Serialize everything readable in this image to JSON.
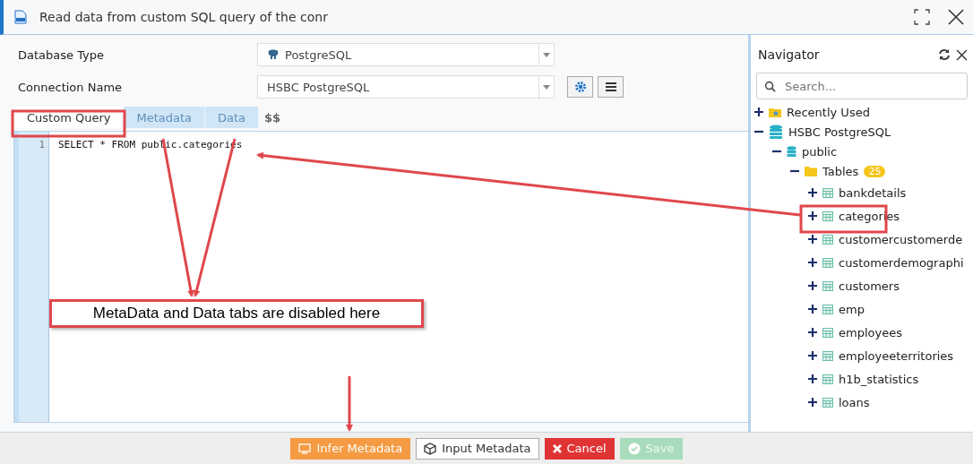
{
  "window": {
    "title": "Read data from custom SQL query of the conr"
  },
  "form": {
    "fields": [
      {
        "label": "Database Type",
        "value": "PostgreSQL",
        "kind": "dbtype"
      },
      {
        "label": "Connection Name",
        "value": "HSBC PostgreSQL",
        "kind": "connection"
      }
    ]
  },
  "tabs": [
    {
      "label": "Custom Query",
      "selected": true,
      "disabled": false
    },
    {
      "label": "Metadata",
      "selected": false,
      "disabled": true
    },
    {
      "label": "Data",
      "selected": false,
      "disabled": true
    }
  ],
  "tabs_extra": "$$",
  "editor": {
    "lines": [
      {
        "number": "1",
        "text": "SELECT * FROM public.categories"
      }
    ]
  },
  "annotation": {
    "callout": "MetaData and Data tabs are disabled here"
  },
  "navigator": {
    "title": "Navigator",
    "search": {
      "placeholder": "Search..."
    },
    "tree": [
      {
        "label": "Recently Used",
        "kind": "recent",
        "expanded": false
      },
      {
        "label": "HSBC PostgreSQL",
        "kind": "database",
        "expanded": true,
        "children": [
          {
            "label": "public",
            "kind": "schema",
            "expanded": true,
            "children": [
              {
                "label": "Tables",
                "kind": "folder",
                "badge": "25",
                "expanded": true,
                "children": [
                  {
                    "label": "bankdetails",
                    "kind": "table",
                    "expanded": false
                  },
                  {
                    "label": "categories",
                    "kind": "table",
                    "expanded": false
                  },
                  {
                    "label": "customercustomerde",
                    "kind": "table",
                    "expanded": false
                  },
                  {
                    "label": "customerdemographi",
                    "kind": "table",
                    "expanded": false
                  },
                  {
                    "label": "customers",
                    "kind": "table",
                    "expanded": false
                  },
                  {
                    "label": "emp",
                    "kind": "table",
                    "expanded": false
                  },
                  {
                    "label": "employees",
                    "kind": "table",
                    "expanded": false
                  },
                  {
                    "label": "employeeterritories",
                    "kind": "table",
                    "expanded": false
                  },
                  {
                    "label": "h1b_statistics",
                    "kind": "table",
                    "expanded": false
                  },
                  {
                    "label": "loans",
                    "kind": "table",
                    "expanded": false
                  }
                ]
              }
            ]
          }
        ]
      }
    ]
  },
  "buttons": [
    {
      "label": "Infer Metadata",
      "kind": "infer",
      "disabled": false
    },
    {
      "label": "Input Metadata",
      "kind": "input",
      "disabled": false
    },
    {
      "label": "Cancel",
      "kind": "cancel",
      "disabled": false
    },
    {
      "label": "Save",
      "kind": "save",
      "disabled": true
    }
  ]
}
